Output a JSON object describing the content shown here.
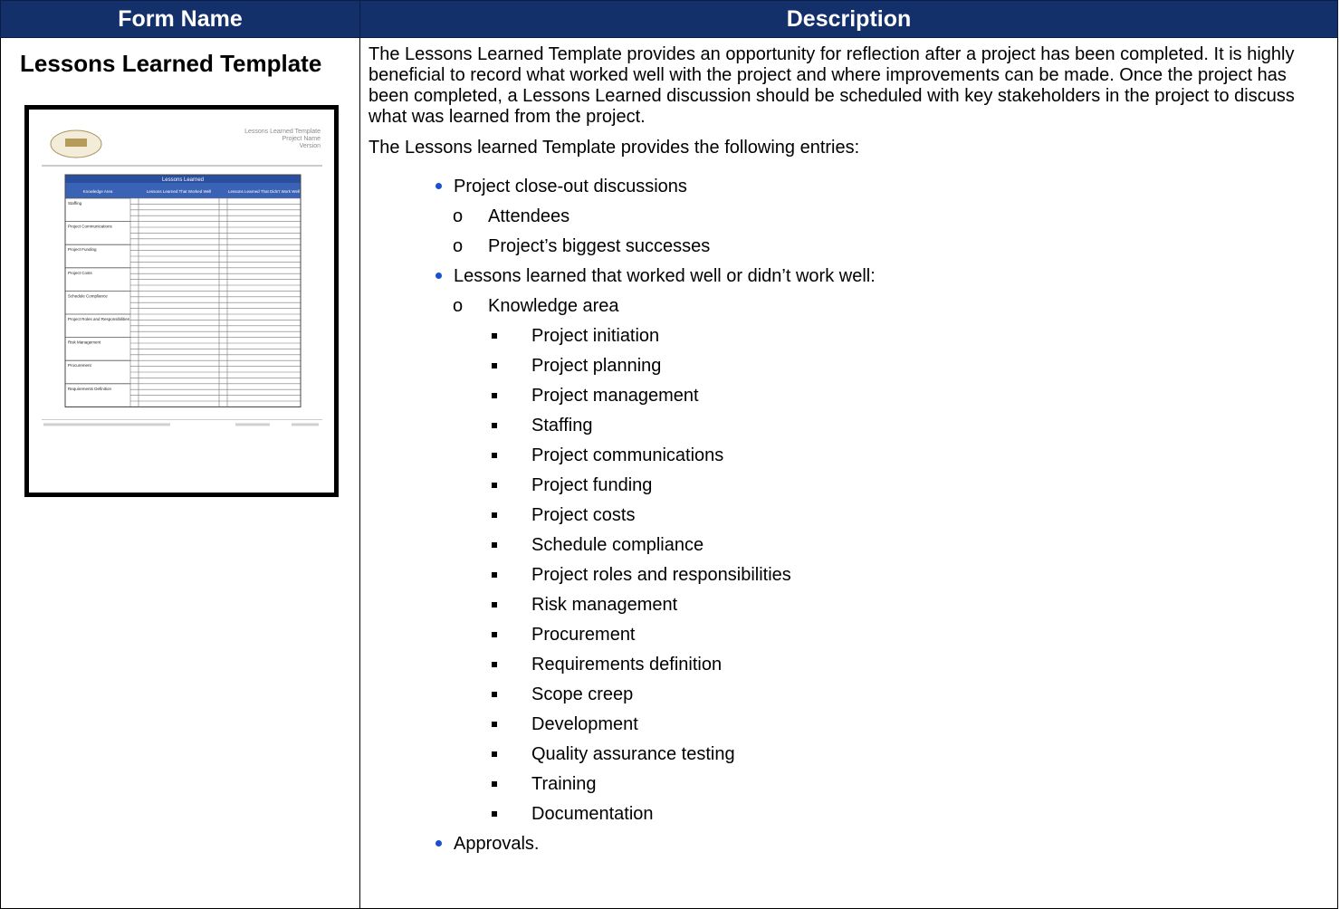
{
  "header": {
    "col_form_name": "Form Name",
    "col_description": "Description"
  },
  "form": {
    "title": "Lessons Learned Template",
    "thumbnail": {
      "header_lines": [
        "Lessons Learned Template",
        "Project Name",
        "Version"
      ],
      "table_title": "Lessons Learned",
      "col_headers": [
        "Knowledge Area",
        "Lessons Learned That Worked Well",
        "Lessons Learned That Didn't Work Well"
      ],
      "areas": [
        "Staffing",
        "Project Communications",
        "Project Funding",
        "Project Costs",
        "Schedule Compliance",
        "Project Roles and Responsibilities",
        "Risk Management",
        "Procurement",
        "Requirements Definition"
      ]
    }
  },
  "description": {
    "intro": "The Lessons Learned Template provides an opportunity for reflection after a project has been completed. It is highly beneficial to record what worked well with the project and where improvements can be made. Once the project has been completed, a Lessons Learned discussion should be scheduled with key stakeholders in the project to discuss what was learned from the project.",
    "entries_intro": "The Lessons learned Template provides the following entries:",
    "entries": [
      {
        "label": "Project close-out discussions",
        "children": [
          {
            "label": "Attendees"
          },
          {
            "label": "Project’s biggest successes"
          }
        ]
      },
      {
        "label": "Lessons learned that worked well or didn’t work well:",
        "children": [
          {
            "label": "Knowledge area",
            "children": [
              "Project initiation",
              "Project planning",
              "Project management",
              "Staffing",
              "Project communications",
              "Project funding",
              "Project costs",
              "Schedule compliance",
              "Project roles and responsibilities",
              "Risk management",
              "Procurement",
              "Requirements definition",
              "Scope creep",
              "Development",
              "Quality assurance testing",
              "Training",
              "Documentation"
            ]
          }
        ]
      },
      {
        "label": "Approvals.",
        "children": []
      }
    ]
  },
  "colors": {
    "header_bg": "#13306a",
    "header_text": "#ffffff",
    "bullet": "#1a4fcf"
  }
}
